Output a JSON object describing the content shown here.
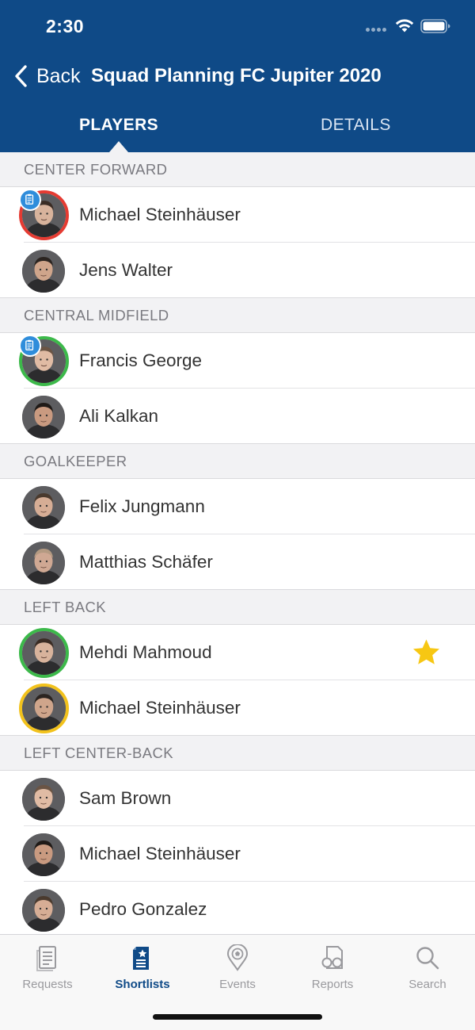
{
  "status_bar": {
    "time": "2:30"
  },
  "nav": {
    "back_label": "Back",
    "title": "Squad Planning FC Jupiter 2020"
  },
  "tabs": [
    {
      "label": "PLAYERS",
      "active": true
    },
    {
      "label": "DETAILS",
      "active": false
    }
  ],
  "sections": [
    {
      "title": "CENTER FORWARD",
      "players": [
        {
          "name": "Michael Steinhäuser",
          "ring": "#e53b32",
          "report_badge": true,
          "favorite": false
        },
        {
          "name": "Jens Walter",
          "ring": null,
          "report_badge": false,
          "favorite": false
        }
      ]
    },
    {
      "title": "CENTRAL MIDFIELD",
      "players": [
        {
          "name": "Francis George",
          "ring": "#3cb94a",
          "report_badge": true,
          "favorite": false
        },
        {
          "name": "Ali Kalkan",
          "ring": null,
          "report_badge": false,
          "favorite": false
        }
      ]
    },
    {
      "title": "GOALKEEPER",
      "players": [
        {
          "name": "Felix Jungmann",
          "ring": null,
          "report_badge": false,
          "favorite": false
        },
        {
          "name": "Matthias  Schäfer",
          "ring": null,
          "report_badge": false,
          "favorite": false
        }
      ]
    },
    {
      "title": "LEFT BACK",
      "players": [
        {
          "name": "Mehdi Mahmoud",
          "ring": "#3cb94a",
          "report_badge": false,
          "favorite": true
        },
        {
          "name": "Michael Steinhäuser",
          "ring": "#f2c21c",
          "report_badge": false,
          "favorite": false
        }
      ]
    },
    {
      "title": "LEFT CENTER-BACK",
      "players": [
        {
          "name": "Sam Brown",
          "ring": null,
          "report_badge": false,
          "favorite": false
        },
        {
          "name": "Michael Steinhäuser",
          "ring": null,
          "report_badge": false,
          "favorite": false
        },
        {
          "name": "Pedro Gonzalez",
          "ring": null,
          "report_badge": false,
          "favorite": false
        }
      ]
    }
  ],
  "bottom_nav": [
    {
      "label": "Requests",
      "icon": "requests-icon",
      "active": false
    },
    {
      "label": "Shortlists",
      "icon": "shortlists-icon",
      "active": true
    },
    {
      "label": "Events",
      "icon": "events-icon",
      "active": false
    },
    {
      "label": "Reports",
      "icon": "reports-icon",
      "active": false
    },
    {
      "label": "Search",
      "icon": "search-icon",
      "active": false
    }
  ],
  "colors": {
    "header": "#0f4a87",
    "accent": "#0f4a87",
    "ring_red": "#e53b32",
    "ring_green": "#3cb94a",
    "ring_yellow": "#f2c21c",
    "badge_blue": "#2f8ddb",
    "star": "#f7c713"
  }
}
